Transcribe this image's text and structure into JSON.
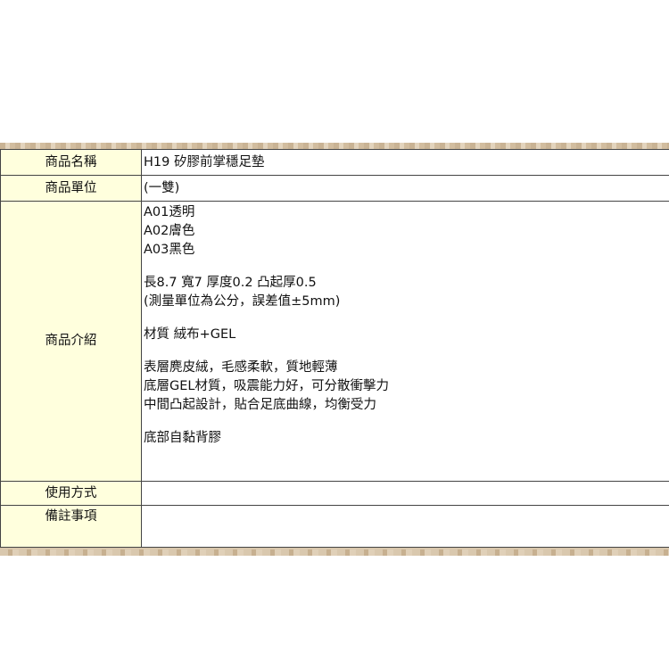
{
  "table": {
    "product_name": {
      "label": "商品名稱",
      "value": "H19 矽膠前掌穩足墊"
    },
    "product_unit": {
      "label": "商品單位",
      "value": "(一雙)"
    },
    "product_intro": {
      "label": "商品介紹",
      "paragraphs": [
        [
          "A01透明",
          "A02膚色",
          "A03黑色"
        ],
        [
          "長8.7 寬7 厚度0.2 凸起厚0.5",
          "(測量單位為公分，誤差值±5mm)"
        ],
        [
          "材質 絨布+GEL"
        ],
        [
          "表層麂皮絨，毛感柔軟，質地輕薄",
          "底層GEL材質，吸震能力好，可分散衝擊力",
          "中間凸起設計，貼合足底曲線，均衡受力"
        ],
        [
          "底部自黏背膠"
        ]
      ]
    },
    "usage": {
      "label": "使用方式",
      "value": ""
    },
    "notes": {
      "label": "備註事項",
      "value": ""
    }
  }
}
